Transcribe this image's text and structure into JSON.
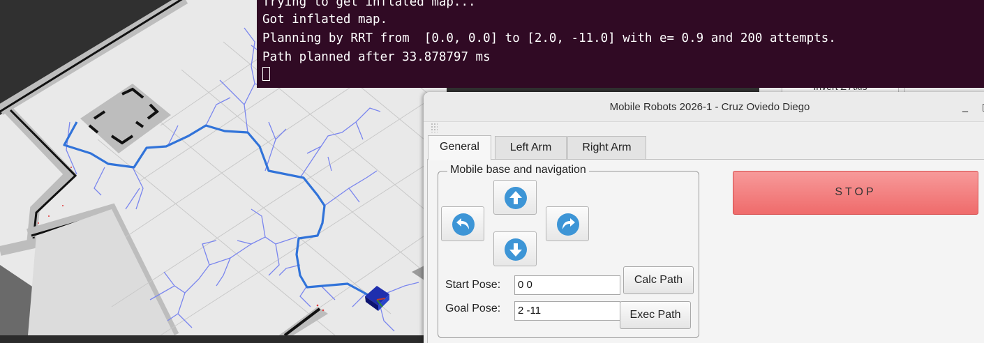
{
  "terminal": {
    "lines": [
      "Trying to get inflated map...",
      "Got inflated map.",
      "Planning by RRT from  [0.0, 0.0] to [2.0, -11.0] with e= 0.9 and 200 attempts.",
      "Path planned after 33.878797 ms"
    ],
    "background": "#300a24"
  },
  "rviz": {
    "partial_button_label": "Invert Z Axis"
  },
  "window": {
    "title": "Mobile Robots 2026-1 - Cruz Oviedo Diego",
    "minimize_glyph": "_",
    "maximize_glyph": "▯"
  },
  "tabs": [
    {
      "label": "General",
      "active": true
    },
    {
      "label": "Left Arm",
      "active": false
    },
    {
      "label": "Right Arm",
      "active": false
    }
  ],
  "navigation": {
    "group_title": "Mobile base and navigation",
    "arrow_icons": [
      "arrow-up-icon",
      "turn-left-icon",
      "turn-right-icon",
      "arrow-down-icon"
    ],
    "arrow_color": "#3d95d6",
    "start_pose_label": "Start Pose:",
    "start_pose_value": "0 0",
    "goal_pose_label": "Goal Pose:",
    "goal_pose_value": "2 -11",
    "calc_path_label": "Calc Path",
    "exec_path_label": "Exec Path"
  },
  "stop": {
    "label": "STOP",
    "color": "#ef7b7b"
  },
  "map": {
    "path_color": "#3173d9",
    "tree_color": "#7a86ee"
  }
}
